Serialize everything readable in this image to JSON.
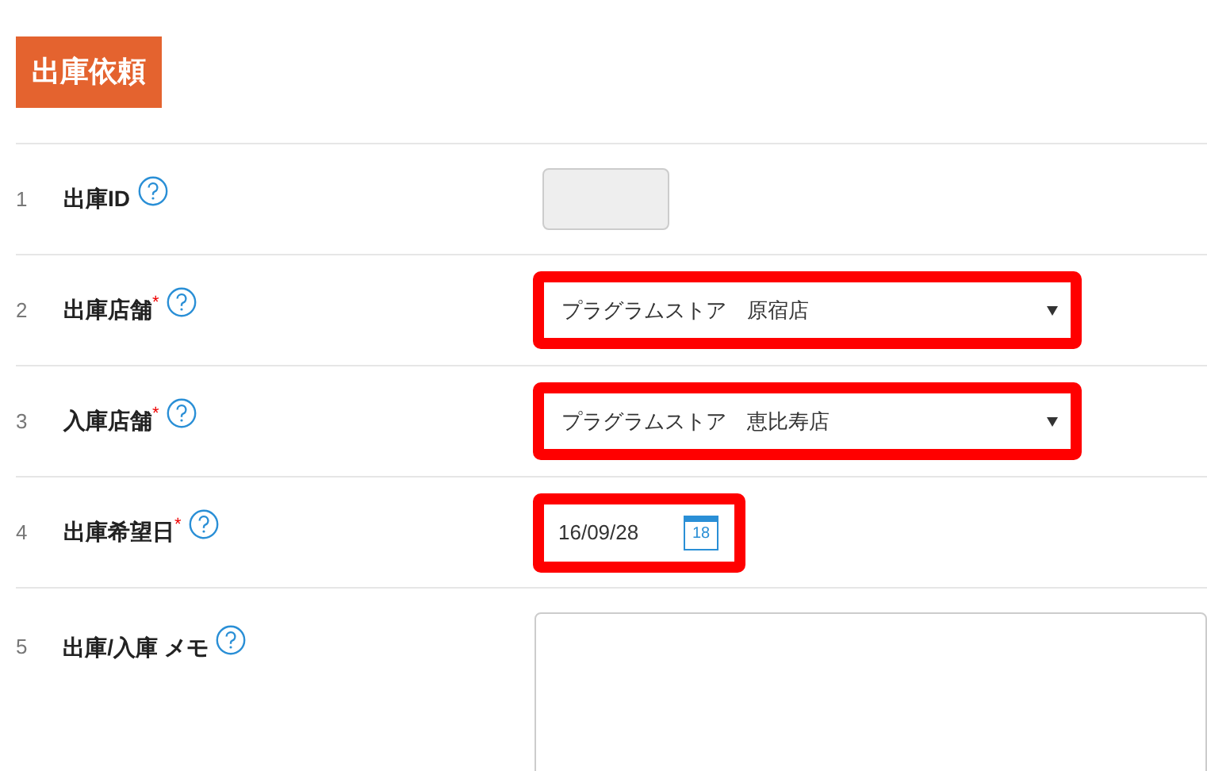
{
  "title": "出庫依頼",
  "fields": [
    {
      "number": "1",
      "label": "出庫ID",
      "kind": "readonly"
    },
    {
      "number": "2",
      "label": "出庫店舗",
      "required_mark": "*",
      "kind": "select",
      "value": "プラグラムストア　原宿店",
      "highlighted": true
    },
    {
      "number": "3",
      "label": "入庫店舗",
      "required_mark": "*",
      "kind": "select",
      "value": "プラグラムストア　恵比寿店",
      "highlighted": true
    },
    {
      "number": "4",
      "label": "出庫希望日",
      "required_mark": "*",
      "kind": "date",
      "value": "16/09/28",
      "calendar_day": "18",
      "highlighted": true
    },
    {
      "number": "5",
      "label": "出庫/入庫 メモ",
      "kind": "textarea"
    }
  ]
}
